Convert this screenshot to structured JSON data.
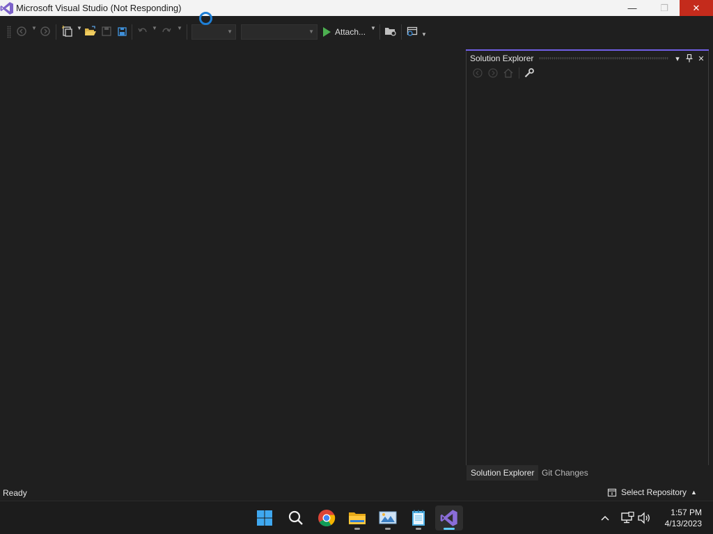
{
  "window": {
    "title": "Microsoft Visual Studio (Not Responding)",
    "minimize_glyph": "—",
    "maximize_glyph": "❐",
    "close_glyph": "✕"
  },
  "toolbar": {
    "attach_label": "Attach...",
    "config_combo_value": "",
    "platform_combo_value": "",
    "icons": [
      "navigate-back-icon",
      "navigate-forward-icon",
      "new-project-icon",
      "open-file-icon",
      "save-icon",
      "save-all-icon",
      "undo-icon",
      "redo-icon",
      "start-play-icon",
      "file-explorer-icon",
      "window-layout-icon"
    ]
  },
  "solution_explorer": {
    "title": "Solution Explorer",
    "dropdown_glyph": "▾",
    "pin_glyph": "⊥",
    "close_glyph": "✕",
    "tabs": [
      {
        "label": "Solution Explorer",
        "active": true
      },
      {
        "label": "Git Changes",
        "active": false
      }
    ]
  },
  "status_bar": {
    "status": "Ready",
    "repo_label": "Select Repository",
    "repo_arrow": "▲"
  },
  "taskbar": {
    "apps": [
      "start",
      "search",
      "chrome",
      "file-explorer",
      "photos",
      "notepad",
      "visual-studio"
    ],
    "tray_up_arrow": "^",
    "time": "1:57 PM",
    "date": "4/13/2023"
  },
  "colors": {
    "accent": "#7160e8",
    "close_red": "#c42b1c",
    "run_green": "#4caf50",
    "busy_blue": "#1e7fd6",
    "taskbar_active": "#60cdff"
  }
}
